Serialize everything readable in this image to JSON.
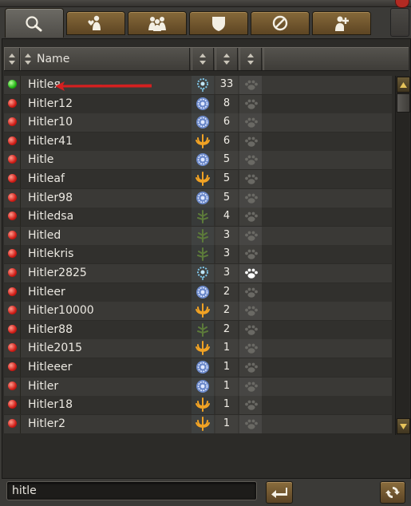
{
  "tabs": [
    {
      "id": "search",
      "icon": "magnifier-icon",
      "active": true
    },
    {
      "id": "friend",
      "icon": "person-heart-icon",
      "active": false
    },
    {
      "id": "group",
      "icon": "group-icon",
      "active": false
    },
    {
      "id": "clan",
      "icon": "shield-icon",
      "active": false
    },
    {
      "id": "ignore",
      "icon": "block-icon",
      "active": false
    },
    {
      "id": "add",
      "icon": "person-add-icon",
      "active": false
    }
  ],
  "header": {
    "name_label": "Name"
  },
  "colors": {
    "online": "#22b514",
    "offline": "#d01d17",
    "annotation_arrow": "#d42020"
  },
  "players": [
    {
      "name": "Hitleя",
      "online": true,
      "clan": "blue-flower",
      "level": "33",
      "friend": "paw-dim"
    },
    {
      "name": "Hitler12",
      "online": false,
      "clan": "blue-round",
      "level": "8",
      "friend": "paw-dim"
    },
    {
      "name": "Hitler10",
      "online": false,
      "clan": "blue-round",
      "level": "6",
      "friend": "paw-dim"
    },
    {
      "name": "Hitler41",
      "online": false,
      "clan": "orange-trident",
      "level": "6",
      "friend": "paw-dim"
    },
    {
      "name": "Hitle",
      "online": false,
      "clan": "blue-round",
      "level": "5",
      "friend": "paw-dim"
    },
    {
      "name": "Hitleaf",
      "online": false,
      "clan": "orange-trident",
      "level": "5",
      "friend": "paw-dim"
    },
    {
      "name": "Hitler98",
      "online": false,
      "clan": "blue-round",
      "level": "5",
      "friend": "paw-dim"
    },
    {
      "name": "Hitledsa",
      "online": false,
      "clan": "green-plant",
      "level": "4",
      "friend": "paw-dim"
    },
    {
      "name": "Hitled",
      "online": false,
      "clan": "green-plant",
      "level": "3",
      "friend": "paw-dim"
    },
    {
      "name": "Hitlekris",
      "online": false,
      "clan": "green-plant",
      "level": "3",
      "friend": "paw-dim"
    },
    {
      "name": "Hitler2825",
      "online": false,
      "clan": "blue-flower",
      "level": "3",
      "friend": "paw-bright"
    },
    {
      "name": "Hitleer",
      "online": false,
      "clan": "blue-round",
      "level": "2",
      "friend": "paw-dim"
    },
    {
      "name": "Hitler10000",
      "online": false,
      "clan": "orange-trident",
      "level": "2",
      "friend": "paw-dim"
    },
    {
      "name": "Hitler88",
      "online": false,
      "clan": "green-plant",
      "level": "2",
      "friend": "paw-dim"
    },
    {
      "name": "Hitle2015",
      "online": false,
      "clan": "orange-trident",
      "level": "1",
      "friend": "paw-dim"
    },
    {
      "name": "Hitleeer",
      "online": false,
      "clan": "blue-round",
      "level": "1",
      "friend": "paw-dim"
    },
    {
      "name": "Hitler",
      "online": false,
      "clan": "blue-round",
      "level": "1",
      "friend": "paw-dim"
    },
    {
      "name": "Hitler18",
      "online": false,
      "clan": "orange-trident",
      "level": "1",
      "friend": "paw-dim"
    },
    {
      "name": "Hitler2",
      "online": false,
      "clan": "orange-trident",
      "level": "1",
      "friend": "paw-dim"
    }
  ],
  "search": {
    "value": "hitle"
  }
}
